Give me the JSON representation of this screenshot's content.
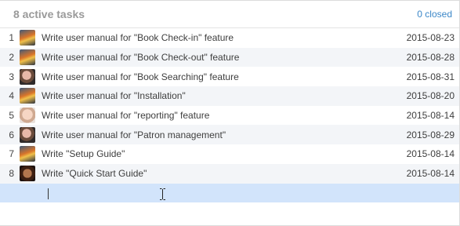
{
  "header": {
    "title": "8 active tasks",
    "closed_link": "0 closed"
  },
  "tasks": [
    {
      "num": "1",
      "avatar": "rocket-avatar",
      "text": "Write user manual for \"Book Check-in\" feature",
      "date": "2015-08-23"
    },
    {
      "num": "2",
      "avatar": "rocket-avatar",
      "text": "Write user manual for \"Book Check-out\" feature",
      "date": "2015-08-28"
    },
    {
      "num": "3",
      "avatar": "child-avatar",
      "text": "Write user manual for \"Book Searching\" feature",
      "date": "2015-08-31"
    },
    {
      "num": "4",
      "avatar": "rocket-avatar",
      "text": "Write user manual for \"Installation\"",
      "date": "2015-08-20"
    },
    {
      "num": "5",
      "avatar": "baby-avatar",
      "text": "Write user manual for \"reporting\" feature",
      "date": "2015-08-14"
    },
    {
      "num": "6",
      "avatar": "child-avatar",
      "text": "Write user manual for \"Patron management\"",
      "date": "2015-08-29"
    },
    {
      "num": "7",
      "avatar": "rocket-avatar",
      "text": "Write \"Setup Guide\"",
      "date": "2015-08-14"
    },
    {
      "num": "8",
      "avatar": "man-avatar",
      "text": "Write \"Quick Start Guide\"",
      "date": "2015-08-14"
    }
  ],
  "new_task": {
    "value": ""
  },
  "colors": {
    "accent": "#3b87c8",
    "row_alt": "#f3f5f8",
    "new_row": "#d2e4fb"
  }
}
